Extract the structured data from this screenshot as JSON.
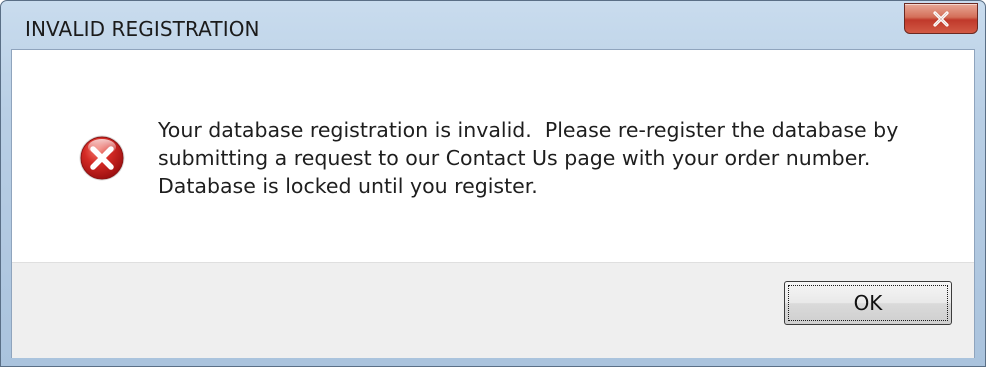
{
  "window": {
    "title": "INVALID REGISTRATION"
  },
  "titlebar": {
    "close_icon": "close-icon"
  },
  "message": {
    "icon": "error-icon",
    "lines": [
      "Your database registration is invalid.  Please re-register the database by",
      "submitting a request to our Contact Us page with your order number.",
      "Database is locked until you register."
    ]
  },
  "buttons": {
    "ok_label": "OK"
  },
  "colors": {
    "error_red": "#c4161c",
    "close_button_red": "#c0392b",
    "titlebar_blue": "#b9cfe5"
  }
}
